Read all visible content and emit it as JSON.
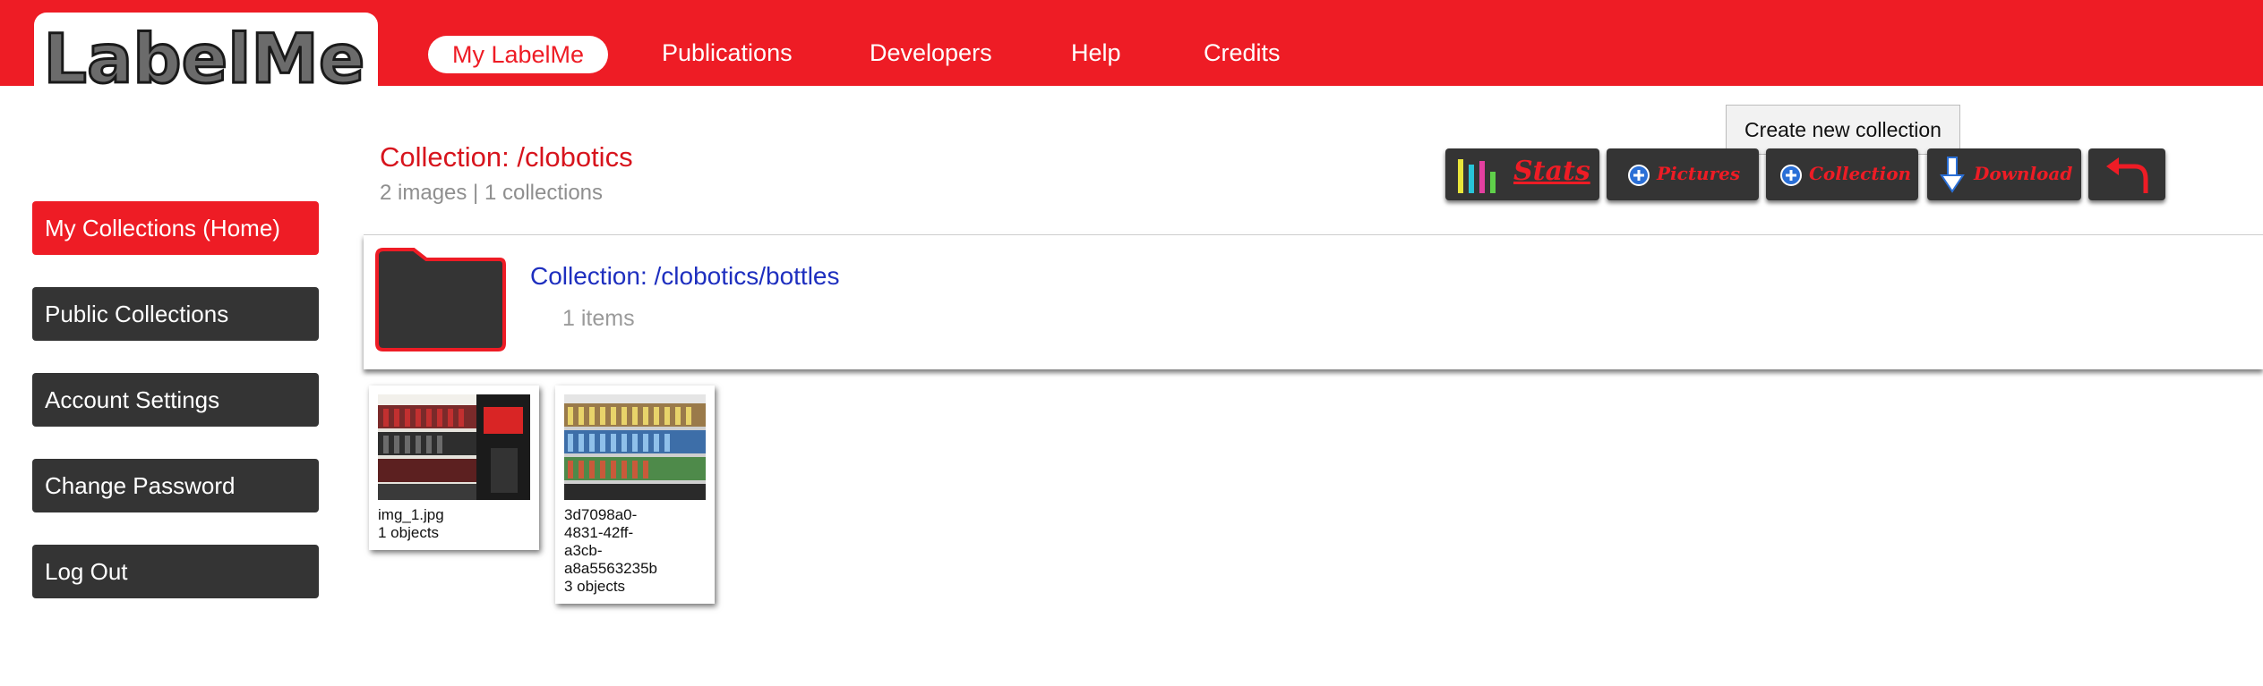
{
  "header": {
    "logo_text": "LabelMe",
    "nav": [
      {
        "label": "My LabelMe",
        "active": true
      },
      {
        "label": "Publications"
      },
      {
        "label": "Developers"
      },
      {
        "label": "Help"
      },
      {
        "label": "Credits"
      }
    ]
  },
  "sidebar": {
    "items": [
      {
        "label": "My Collections (Home)",
        "active": true
      },
      {
        "label": "Public Collections"
      },
      {
        "label": "Account Settings"
      },
      {
        "label": "Change Password"
      },
      {
        "label": "Log Out"
      }
    ]
  },
  "collection": {
    "title": "Collection: /clobotics",
    "summary": "2 images | 1 collections"
  },
  "toolbar": {
    "tooltip": "Create new collection",
    "stats_label": "Stats",
    "pictures_label": "Pictures",
    "collection_label": "Collection",
    "download_label": "Download",
    "back_icon": "back-arrow-icon"
  },
  "subcollection": {
    "title": "Collection: /clobotics/bottles",
    "count": "1 items"
  },
  "images": [
    {
      "name": "img_1.jpg",
      "objects": "1 objects"
    },
    {
      "name_lines": [
        "3d7098a0-",
        "4831-42ff-",
        "a3cb-",
        "a8a5563235b"
      ],
      "objects": "3 objects"
    }
  ],
  "colors": {
    "brand_red": "#ee1c25",
    "dark_button": "#343434",
    "link_blue": "#1e2fbf"
  }
}
